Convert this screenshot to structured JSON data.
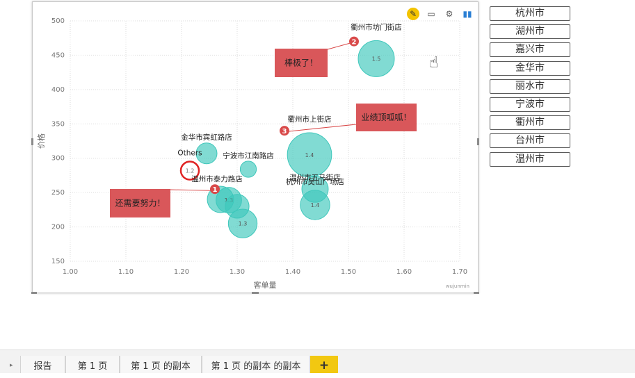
{
  "visual": {
    "header_icons": [
      "focus-mode-icon",
      "comment-icon",
      "gear-icon",
      "analytics-icon"
    ],
    "watermark": "wujunmin"
  },
  "chart_data": {
    "type": "scatter",
    "xlabel": "客单量",
    "ylabel": "价格",
    "xlim": [
      1.0,
      1.7
    ],
    "ylim": [
      150,
      500
    ],
    "x_ticks": [
      "1.00",
      "1.10",
      "1.20",
      "1.30",
      "1.40",
      "1.50",
      "1.60",
      "1.70"
    ],
    "y_ticks": [
      "150",
      "200",
      "250",
      "300",
      "350",
      "400",
      "450",
      "500"
    ],
    "points": [
      {
        "name": "衢州市坊门街店",
        "x": 1.55,
        "y": 445,
        "label": "1.5",
        "size": 3
      },
      {
        "name": "衢州市上街店",
        "x": 1.43,
        "y": 305,
        "label": "1.4",
        "size": 4.5
      },
      {
        "name": "金华市宾虹路店",
        "x": 1.245,
        "y": 307,
        "label": "",
        "size": 1
      },
      {
        "name": "宁波市江南路店",
        "x": 1.32,
        "y": 284,
        "label": "",
        "size": 0.6
      },
      {
        "name": "温州市五马街店",
        "x": 1.44,
        "y": 255,
        "label": "",
        "size": 1.6
      },
      {
        "name": "杭州市吴山广场店",
        "x": 1.44,
        "y": 232,
        "label": "1.4",
        "size": 2.0
      },
      {
        "name": "温州市泰力路店",
        "x": 1.27,
        "y": 240,
        "label": "",
        "size": 1.6
      },
      {
        "name": "",
        "x": 1.285,
        "y": 239,
        "label": "1.3",
        "size": 1.5
      },
      {
        "name": "",
        "x": 1.3,
        "y": 230,
        "label": "",
        "size": 1.3
      },
      {
        "name": "",
        "x": 1.31,
        "y": 205,
        "label": "1.3",
        "size": 1.9
      }
    ],
    "highlight": {
      "name": "Others",
      "x": 1.215,
      "y": 282,
      "label": "1.2"
    },
    "markers": [
      {
        "num": "1",
        "x": 1.26,
        "y": 255
      },
      {
        "num": "2",
        "x": 1.51,
        "y": 470
      },
      {
        "num": "3",
        "x": 1.385,
        "y": 340
      }
    ],
    "callouts": [
      {
        "text": "还需要努力！"
      },
      {
        "text": "棒极了！"
      },
      {
        "text": "业绩顶呱呱！"
      }
    ],
    "colors": {
      "bubble": "#3ec7bb",
      "callout": "#d9575a",
      "marker": "#d94a4a",
      "highlight": "#e02424"
    }
  },
  "slicer": [
    "杭州市",
    "湖州市",
    "嘉兴市",
    "金华市",
    "丽水市",
    "宁波市",
    "衢州市",
    "台州市",
    "温州市"
  ],
  "tabs": [
    "报告",
    "第 1 页",
    "第 1 页 的副本",
    "第 1 页 的副本 的副本",
    "+"
  ]
}
